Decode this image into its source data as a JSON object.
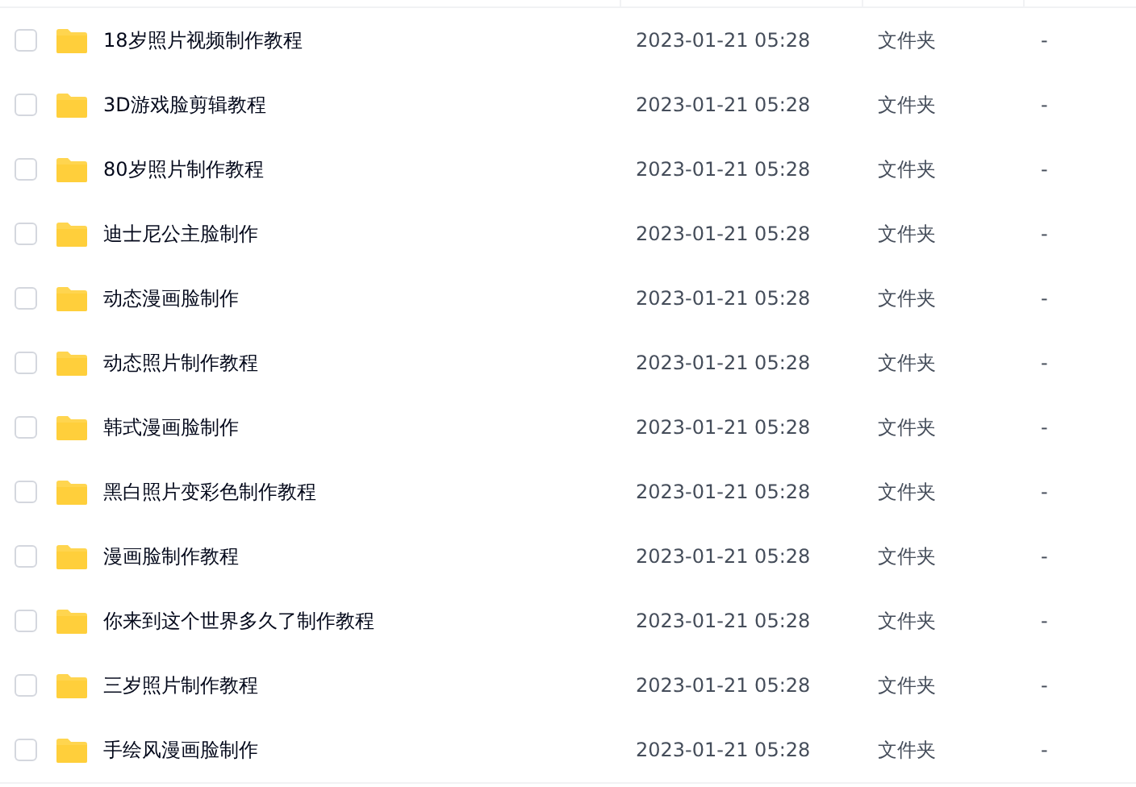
{
  "files": [
    {
      "name": "18岁照片视频制作教程",
      "modified": "2023-01-21 05:28",
      "type": "文件夹",
      "size": "-",
      "checked": false
    },
    {
      "name": "3D游戏脸剪辑教程",
      "modified": "2023-01-21 05:28",
      "type": "文件夹",
      "size": "-",
      "checked": false
    },
    {
      "name": "80岁照片制作教程",
      "modified": "2023-01-21 05:28",
      "type": "文件夹",
      "size": "-",
      "checked": false
    },
    {
      "name": "迪士尼公主脸制作",
      "modified": "2023-01-21 05:28",
      "type": "文件夹",
      "size": "-",
      "checked": false
    },
    {
      "name": "动态漫画脸制作",
      "modified": "2023-01-21 05:28",
      "type": "文件夹",
      "size": "-",
      "checked": false
    },
    {
      "name": "动态照片制作教程",
      "modified": "2023-01-21 05:28",
      "type": "文件夹",
      "size": "-",
      "checked": false
    },
    {
      "name": "韩式漫画脸制作",
      "modified": "2023-01-21 05:28",
      "type": "文件夹",
      "size": "-",
      "checked": false
    },
    {
      "name": "黑白照片变彩色制作教程",
      "modified": "2023-01-21 05:28",
      "type": "文件夹",
      "size": "-",
      "checked": false
    },
    {
      "name": "漫画脸制作教程",
      "modified": "2023-01-21 05:28",
      "type": "文件夹",
      "size": "-",
      "checked": false
    },
    {
      "name": "你来到这个世界多久了制作教程",
      "modified": "2023-01-21 05:28",
      "type": "文件夹",
      "size": "-",
      "checked": false
    },
    {
      "name": "三岁照片制作教程",
      "modified": "2023-01-21 05:28",
      "type": "文件夹",
      "size": "-",
      "checked": false
    },
    {
      "name": "手绘风漫画脸制作",
      "modified": "2023-01-21 05:28",
      "type": "文件夹",
      "size": "-",
      "checked": false
    }
  ]
}
